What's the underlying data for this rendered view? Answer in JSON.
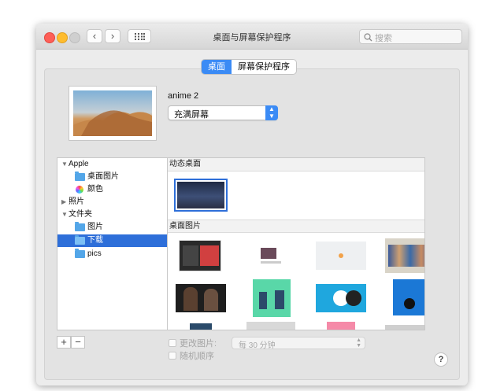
{
  "window": {
    "title": "桌面与屏幕保护程序",
    "search_placeholder": "搜索",
    "back_glyph": "‹",
    "forward_glyph": "›"
  },
  "tabs": [
    {
      "label": "桌面",
      "active": true
    },
    {
      "label": "屏幕保护程序",
      "active": false
    }
  ],
  "current": {
    "image_name": "anime 2",
    "fill_mode": "充满屏幕"
  },
  "sidebar": {
    "items": [
      {
        "label": "Apple",
        "level": 0,
        "disclosure": "▼",
        "icon": "none"
      },
      {
        "label": "桌面图片",
        "level": 1,
        "icon": "folder-icon"
      },
      {
        "label": "颜色",
        "level": 1,
        "icon": "colors-icon"
      },
      {
        "label": "照片",
        "level": 0,
        "disclosure": "▶",
        "icon": "none"
      },
      {
        "label": "文件夹",
        "level": 0,
        "disclosure": "▼",
        "icon": "none"
      },
      {
        "label": "图片",
        "level": 1,
        "icon": "folder-icon"
      },
      {
        "label": "下载",
        "level": 1,
        "icon": "folder-icon",
        "selected": true
      },
      {
        "label": "pics",
        "level": 1,
        "icon": "folder-icon"
      }
    ]
  },
  "sections": {
    "dynamic": "动态桌面",
    "pictures": "桌面图片"
  },
  "bottom": {
    "add": "+",
    "remove": "−",
    "change_picture": "更改图片:",
    "interval": "每 30 分钟",
    "random_order": "随机顺序",
    "help": "?"
  },
  "colors": {
    "accent": "#3b8bf5",
    "selection": "#2e6fd9",
    "folder": "#53a6e8"
  }
}
